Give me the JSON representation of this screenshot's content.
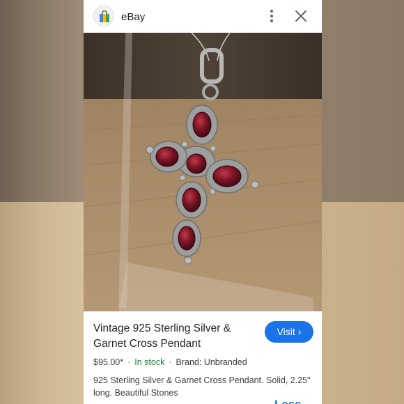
{
  "app": {
    "name": "eBay",
    "icon": "shopping-bag-icon"
  },
  "toolbar": {
    "more_icon": "more-vertical-icon",
    "close_icon": "close-icon"
  },
  "product": {
    "title": "Vintage 925 Sterling Silver & Garnet Cross Pendant",
    "visit_label": "Visit",
    "price": "$95.00*",
    "stock": "In stock",
    "brand": "Brand: Unbranded",
    "description": "925 Sterling Silver & Garnet Cross Pendant. Solid, 2.25\" long. Beautiful Stones",
    "less_label": "Less"
  },
  "colors": {
    "accent": "#1a73e8",
    "in_stock": "#188038"
  }
}
